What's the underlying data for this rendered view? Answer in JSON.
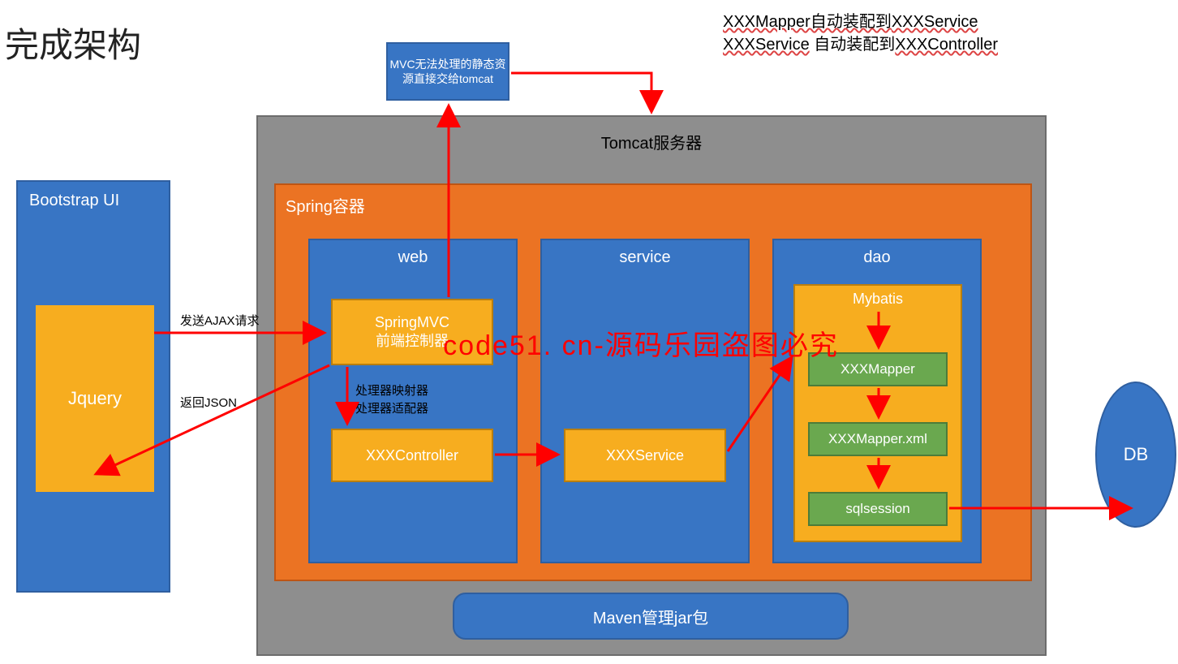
{
  "title": "完成架构",
  "notes": {
    "line1a": "XXXMapper自动装配到",
    "line1b": "XXXService",
    "line2a": "XXXService",
    "line2b": " 自动装配到",
    "line2c": "XXXController"
  },
  "bootstrap": {
    "title": "Bootstrap UI",
    "jquery": "Jquery"
  },
  "labels": {
    "send": "发送AJAX请求",
    "return": "返回JSON",
    "mapper": "处理器映射器",
    "adapter": "处理器适配器"
  },
  "tomcat": {
    "title": "Tomcat服务器",
    "info": "MVC无法处理的静态资源直接交给tomcat"
  },
  "spring": {
    "title": "Spring容器",
    "web": {
      "title": "web",
      "mvc1": "SpringMVC",
      "mvc2": "前端控制器",
      "controller": "XXXController"
    },
    "service": {
      "title": "service",
      "svc": "XXXService"
    },
    "dao": {
      "title": "dao",
      "mybatis": "Mybatis",
      "mapper": "XXXMapper",
      "xml": "XXXMapper.xml",
      "session": "sqlsession"
    }
  },
  "maven": "Maven管理jar包",
  "db": "DB",
  "watermark": "code51. cn-源码乐园盗图必究"
}
